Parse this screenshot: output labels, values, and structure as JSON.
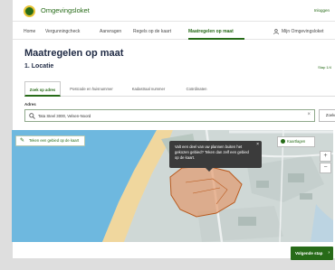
{
  "header": {
    "brand": "Omgevingsloket",
    "login": "Inloggen"
  },
  "nav": {
    "items": [
      {
        "label": "Home"
      },
      {
        "label": "Vergunningcheck"
      },
      {
        "label": "Aanvragen"
      },
      {
        "label": "Regels op de kaart"
      },
      {
        "label": "Maatregelen op maat"
      }
    ],
    "active_index": 4,
    "account_label": "Mijn Omgevingsloket"
  },
  "main": {
    "title": "Maatregelen op maat",
    "step_title": "1. Locatie",
    "step_count": "Stap 1/4",
    "tabs": [
      {
        "label": "Zoek op adres"
      },
      {
        "label": "Postcode en huisnummer"
      },
      {
        "label": "Kadastraal nummer"
      },
      {
        "label": "Coördinaten"
      }
    ],
    "address_label": "Adres",
    "address_value": "Tata Steel 3000, Velsen-Noord",
    "search_button": "Zoeken"
  },
  "map": {
    "draw_button": "Teken een gebied op de kaart",
    "tooltip_text": "Valt een deel van uw plannen buiten het gekozen gebied? Teken dan zelf een gebied op de kaart.",
    "layers_button": "Kaartlagen"
  },
  "footer": {
    "next_button": "Volgende stap"
  },
  "colors": {
    "brand": "#276b18",
    "accent": "#e6c233",
    "highlight": "#e5905c"
  }
}
